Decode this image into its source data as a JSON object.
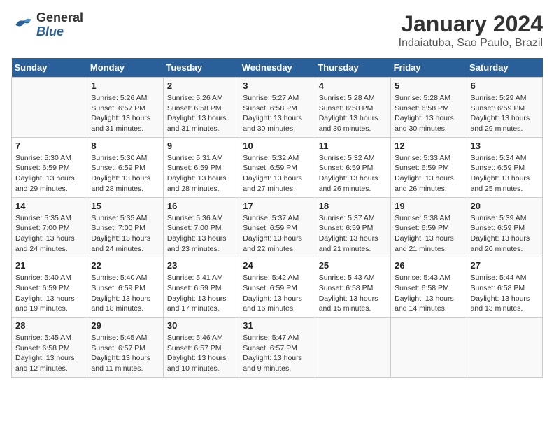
{
  "header": {
    "logo_line1": "General",
    "logo_line2": "Blue",
    "main_title": "January 2024",
    "subtitle": "Indaiatuba, Sao Paulo, Brazil"
  },
  "days_of_week": [
    "Sunday",
    "Monday",
    "Tuesday",
    "Wednesday",
    "Thursday",
    "Friday",
    "Saturday"
  ],
  "weeks": [
    [
      {
        "day": "",
        "info": ""
      },
      {
        "day": "1",
        "info": "Sunrise: 5:26 AM\nSunset: 6:57 PM\nDaylight: 13 hours\nand 31 minutes."
      },
      {
        "day": "2",
        "info": "Sunrise: 5:26 AM\nSunset: 6:58 PM\nDaylight: 13 hours\nand 31 minutes."
      },
      {
        "day": "3",
        "info": "Sunrise: 5:27 AM\nSunset: 6:58 PM\nDaylight: 13 hours\nand 30 minutes."
      },
      {
        "day": "4",
        "info": "Sunrise: 5:28 AM\nSunset: 6:58 PM\nDaylight: 13 hours\nand 30 minutes."
      },
      {
        "day": "5",
        "info": "Sunrise: 5:28 AM\nSunset: 6:58 PM\nDaylight: 13 hours\nand 30 minutes."
      },
      {
        "day": "6",
        "info": "Sunrise: 5:29 AM\nSunset: 6:59 PM\nDaylight: 13 hours\nand 29 minutes."
      }
    ],
    [
      {
        "day": "7",
        "info": "Sunrise: 5:30 AM\nSunset: 6:59 PM\nDaylight: 13 hours\nand 29 minutes."
      },
      {
        "day": "8",
        "info": "Sunrise: 5:30 AM\nSunset: 6:59 PM\nDaylight: 13 hours\nand 28 minutes."
      },
      {
        "day": "9",
        "info": "Sunrise: 5:31 AM\nSunset: 6:59 PM\nDaylight: 13 hours\nand 28 minutes."
      },
      {
        "day": "10",
        "info": "Sunrise: 5:32 AM\nSunset: 6:59 PM\nDaylight: 13 hours\nand 27 minutes."
      },
      {
        "day": "11",
        "info": "Sunrise: 5:32 AM\nSunset: 6:59 PM\nDaylight: 13 hours\nand 26 minutes."
      },
      {
        "day": "12",
        "info": "Sunrise: 5:33 AM\nSunset: 6:59 PM\nDaylight: 13 hours\nand 26 minutes."
      },
      {
        "day": "13",
        "info": "Sunrise: 5:34 AM\nSunset: 6:59 PM\nDaylight: 13 hours\nand 25 minutes."
      }
    ],
    [
      {
        "day": "14",
        "info": "Sunrise: 5:35 AM\nSunset: 7:00 PM\nDaylight: 13 hours\nand 24 minutes."
      },
      {
        "day": "15",
        "info": "Sunrise: 5:35 AM\nSunset: 7:00 PM\nDaylight: 13 hours\nand 24 minutes."
      },
      {
        "day": "16",
        "info": "Sunrise: 5:36 AM\nSunset: 7:00 PM\nDaylight: 13 hours\nand 23 minutes."
      },
      {
        "day": "17",
        "info": "Sunrise: 5:37 AM\nSunset: 6:59 PM\nDaylight: 13 hours\nand 22 minutes."
      },
      {
        "day": "18",
        "info": "Sunrise: 5:37 AM\nSunset: 6:59 PM\nDaylight: 13 hours\nand 21 minutes."
      },
      {
        "day": "19",
        "info": "Sunrise: 5:38 AM\nSunset: 6:59 PM\nDaylight: 13 hours\nand 21 minutes."
      },
      {
        "day": "20",
        "info": "Sunrise: 5:39 AM\nSunset: 6:59 PM\nDaylight: 13 hours\nand 20 minutes."
      }
    ],
    [
      {
        "day": "21",
        "info": "Sunrise: 5:40 AM\nSunset: 6:59 PM\nDaylight: 13 hours\nand 19 minutes."
      },
      {
        "day": "22",
        "info": "Sunrise: 5:40 AM\nSunset: 6:59 PM\nDaylight: 13 hours\nand 18 minutes."
      },
      {
        "day": "23",
        "info": "Sunrise: 5:41 AM\nSunset: 6:59 PM\nDaylight: 13 hours\nand 17 minutes."
      },
      {
        "day": "24",
        "info": "Sunrise: 5:42 AM\nSunset: 6:59 PM\nDaylight: 13 hours\nand 16 minutes."
      },
      {
        "day": "25",
        "info": "Sunrise: 5:43 AM\nSunset: 6:58 PM\nDaylight: 13 hours\nand 15 minutes."
      },
      {
        "day": "26",
        "info": "Sunrise: 5:43 AM\nSunset: 6:58 PM\nDaylight: 13 hours\nand 14 minutes."
      },
      {
        "day": "27",
        "info": "Sunrise: 5:44 AM\nSunset: 6:58 PM\nDaylight: 13 hours\nand 13 minutes."
      }
    ],
    [
      {
        "day": "28",
        "info": "Sunrise: 5:45 AM\nSunset: 6:58 PM\nDaylight: 13 hours\nand 12 minutes."
      },
      {
        "day": "29",
        "info": "Sunrise: 5:45 AM\nSunset: 6:57 PM\nDaylight: 13 hours\nand 11 minutes."
      },
      {
        "day": "30",
        "info": "Sunrise: 5:46 AM\nSunset: 6:57 PM\nDaylight: 13 hours\nand 10 minutes."
      },
      {
        "day": "31",
        "info": "Sunrise: 5:47 AM\nSunset: 6:57 PM\nDaylight: 13 hours\nand 9 minutes."
      },
      {
        "day": "",
        "info": ""
      },
      {
        "day": "",
        "info": ""
      },
      {
        "day": "",
        "info": ""
      }
    ]
  ]
}
